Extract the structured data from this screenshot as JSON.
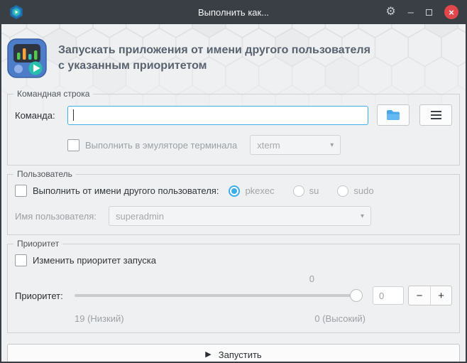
{
  "window": {
    "title": "Выполнить как...",
    "settings_icon": "⚙",
    "minimize_icon": "–",
    "close_icon": "×"
  },
  "header": {
    "title_line1": "Запускать приложения от имени другого пользователя",
    "title_line2": "с указанным приоритетом"
  },
  "command_group": {
    "title": "Командная строка",
    "command_label": "Команда:",
    "command_value": "",
    "terminal_checkbox_label": "Выполнить в эмуляторе терминала",
    "terminal_select_value": "xterm",
    "caret_icon": "▾"
  },
  "user_group": {
    "title": "Пользователь",
    "runas_checkbox_label": "Выполнить от имени другого пользователя:",
    "radios": [
      {
        "label": "pkexec",
        "selected": true
      },
      {
        "label": "su",
        "selected": false
      },
      {
        "label": "sudo",
        "selected": false
      }
    ],
    "username_label": "Имя пользователя:",
    "username_value": "superadmin",
    "caret_icon": "▾"
  },
  "priority_group": {
    "title": "Приоритет",
    "change_checkbox_label": "Изменить приоритет запуска",
    "priority_label": "Приоритет:",
    "slider_value": "0",
    "spin_value": "0",
    "minus_icon": "−",
    "plus_icon": "+",
    "low_label": "19 (Низкий)",
    "high_label": "0 (Высокий)"
  },
  "run_button": {
    "play_icon": "▶",
    "label": "Запустить"
  },
  "colors": {
    "accent_blue": "#3daee9",
    "titlebar": "#3a3f46",
    "close_red": "#e2474b",
    "body_bg": "#eff0f1"
  }
}
